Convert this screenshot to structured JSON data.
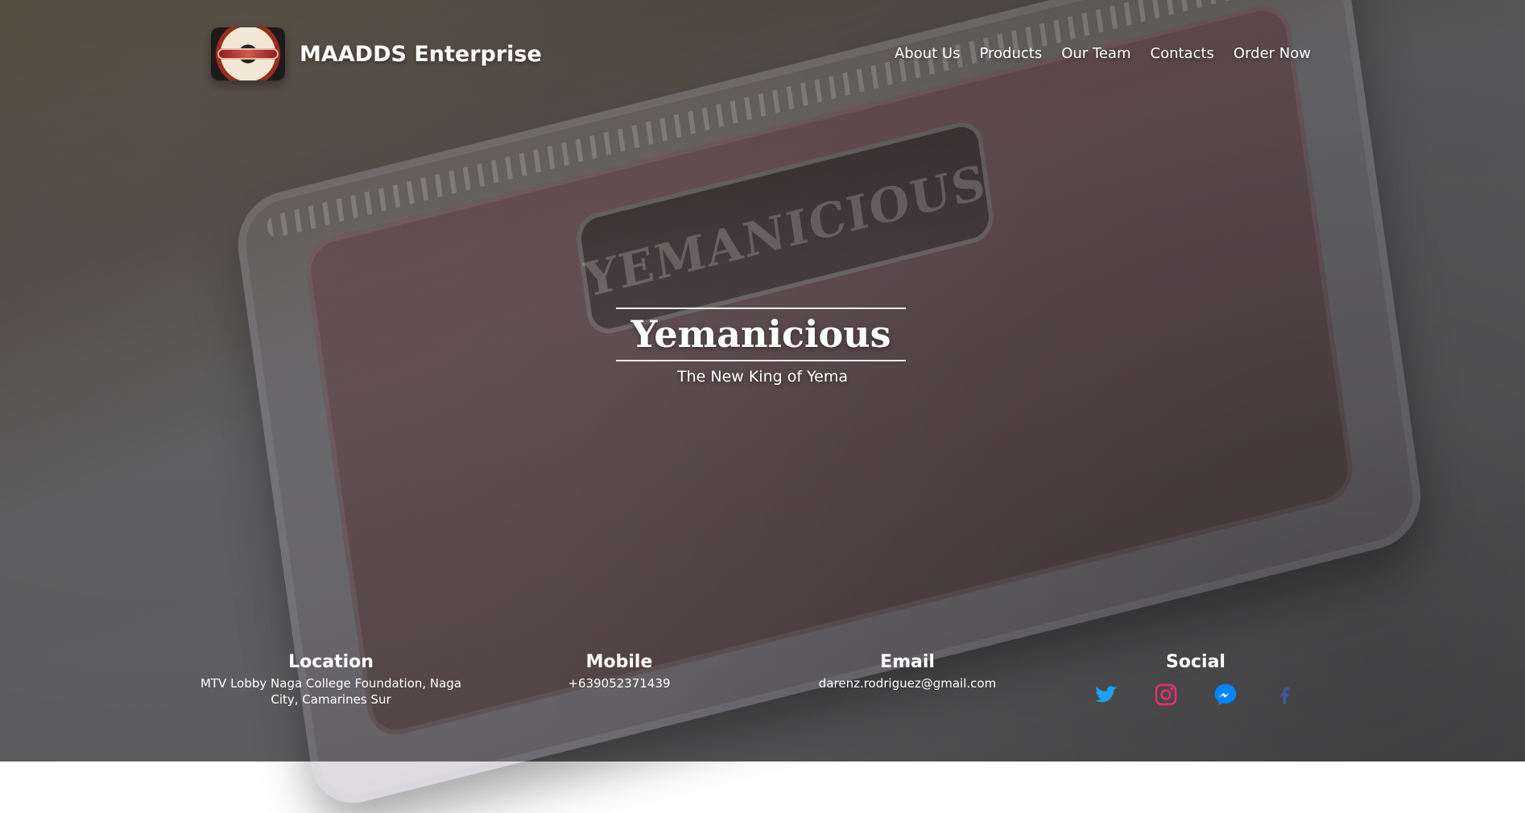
{
  "brand": {
    "name": "MAADDS Enterprise",
    "logo_icon": "yemanicious-logo-icon"
  },
  "nav": {
    "items": [
      {
        "label": "About Us"
      },
      {
        "label": "Products"
      },
      {
        "label": "Our Team"
      },
      {
        "label": "Contacts"
      },
      {
        "label": "Order Now"
      }
    ]
  },
  "hero": {
    "title": "Yemanicious",
    "subtitle": "The New King of Yema",
    "background_text": "YEMANICIOUS",
    "colors": {
      "overlay": "#5a5a5c"
    }
  },
  "footer": {
    "location": {
      "title": "Location",
      "value": "MTV Lobby Naga College Foundation, Naga City, Camarines Sur"
    },
    "mobile": {
      "title": "Mobile",
      "value": "+639052371439"
    },
    "email": {
      "title": "Email",
      "value": "darenz.rodriguez@gmail.com"
    },
    "social": {
      "title": "Social",
      "icons": [
        {
          "name": "twitter-icon",
          "color": "#1DA1F2"
        },
        {
          "name": "instagram-icon",
          "color": "#E1306C"
        },
        {
          "name": "messenger-icon",
          "color": "#0084FF"
        },
        {
          "name": "facebook-icon",
          "color": "#3b5998"
        }
      ]
    }
  }
}
